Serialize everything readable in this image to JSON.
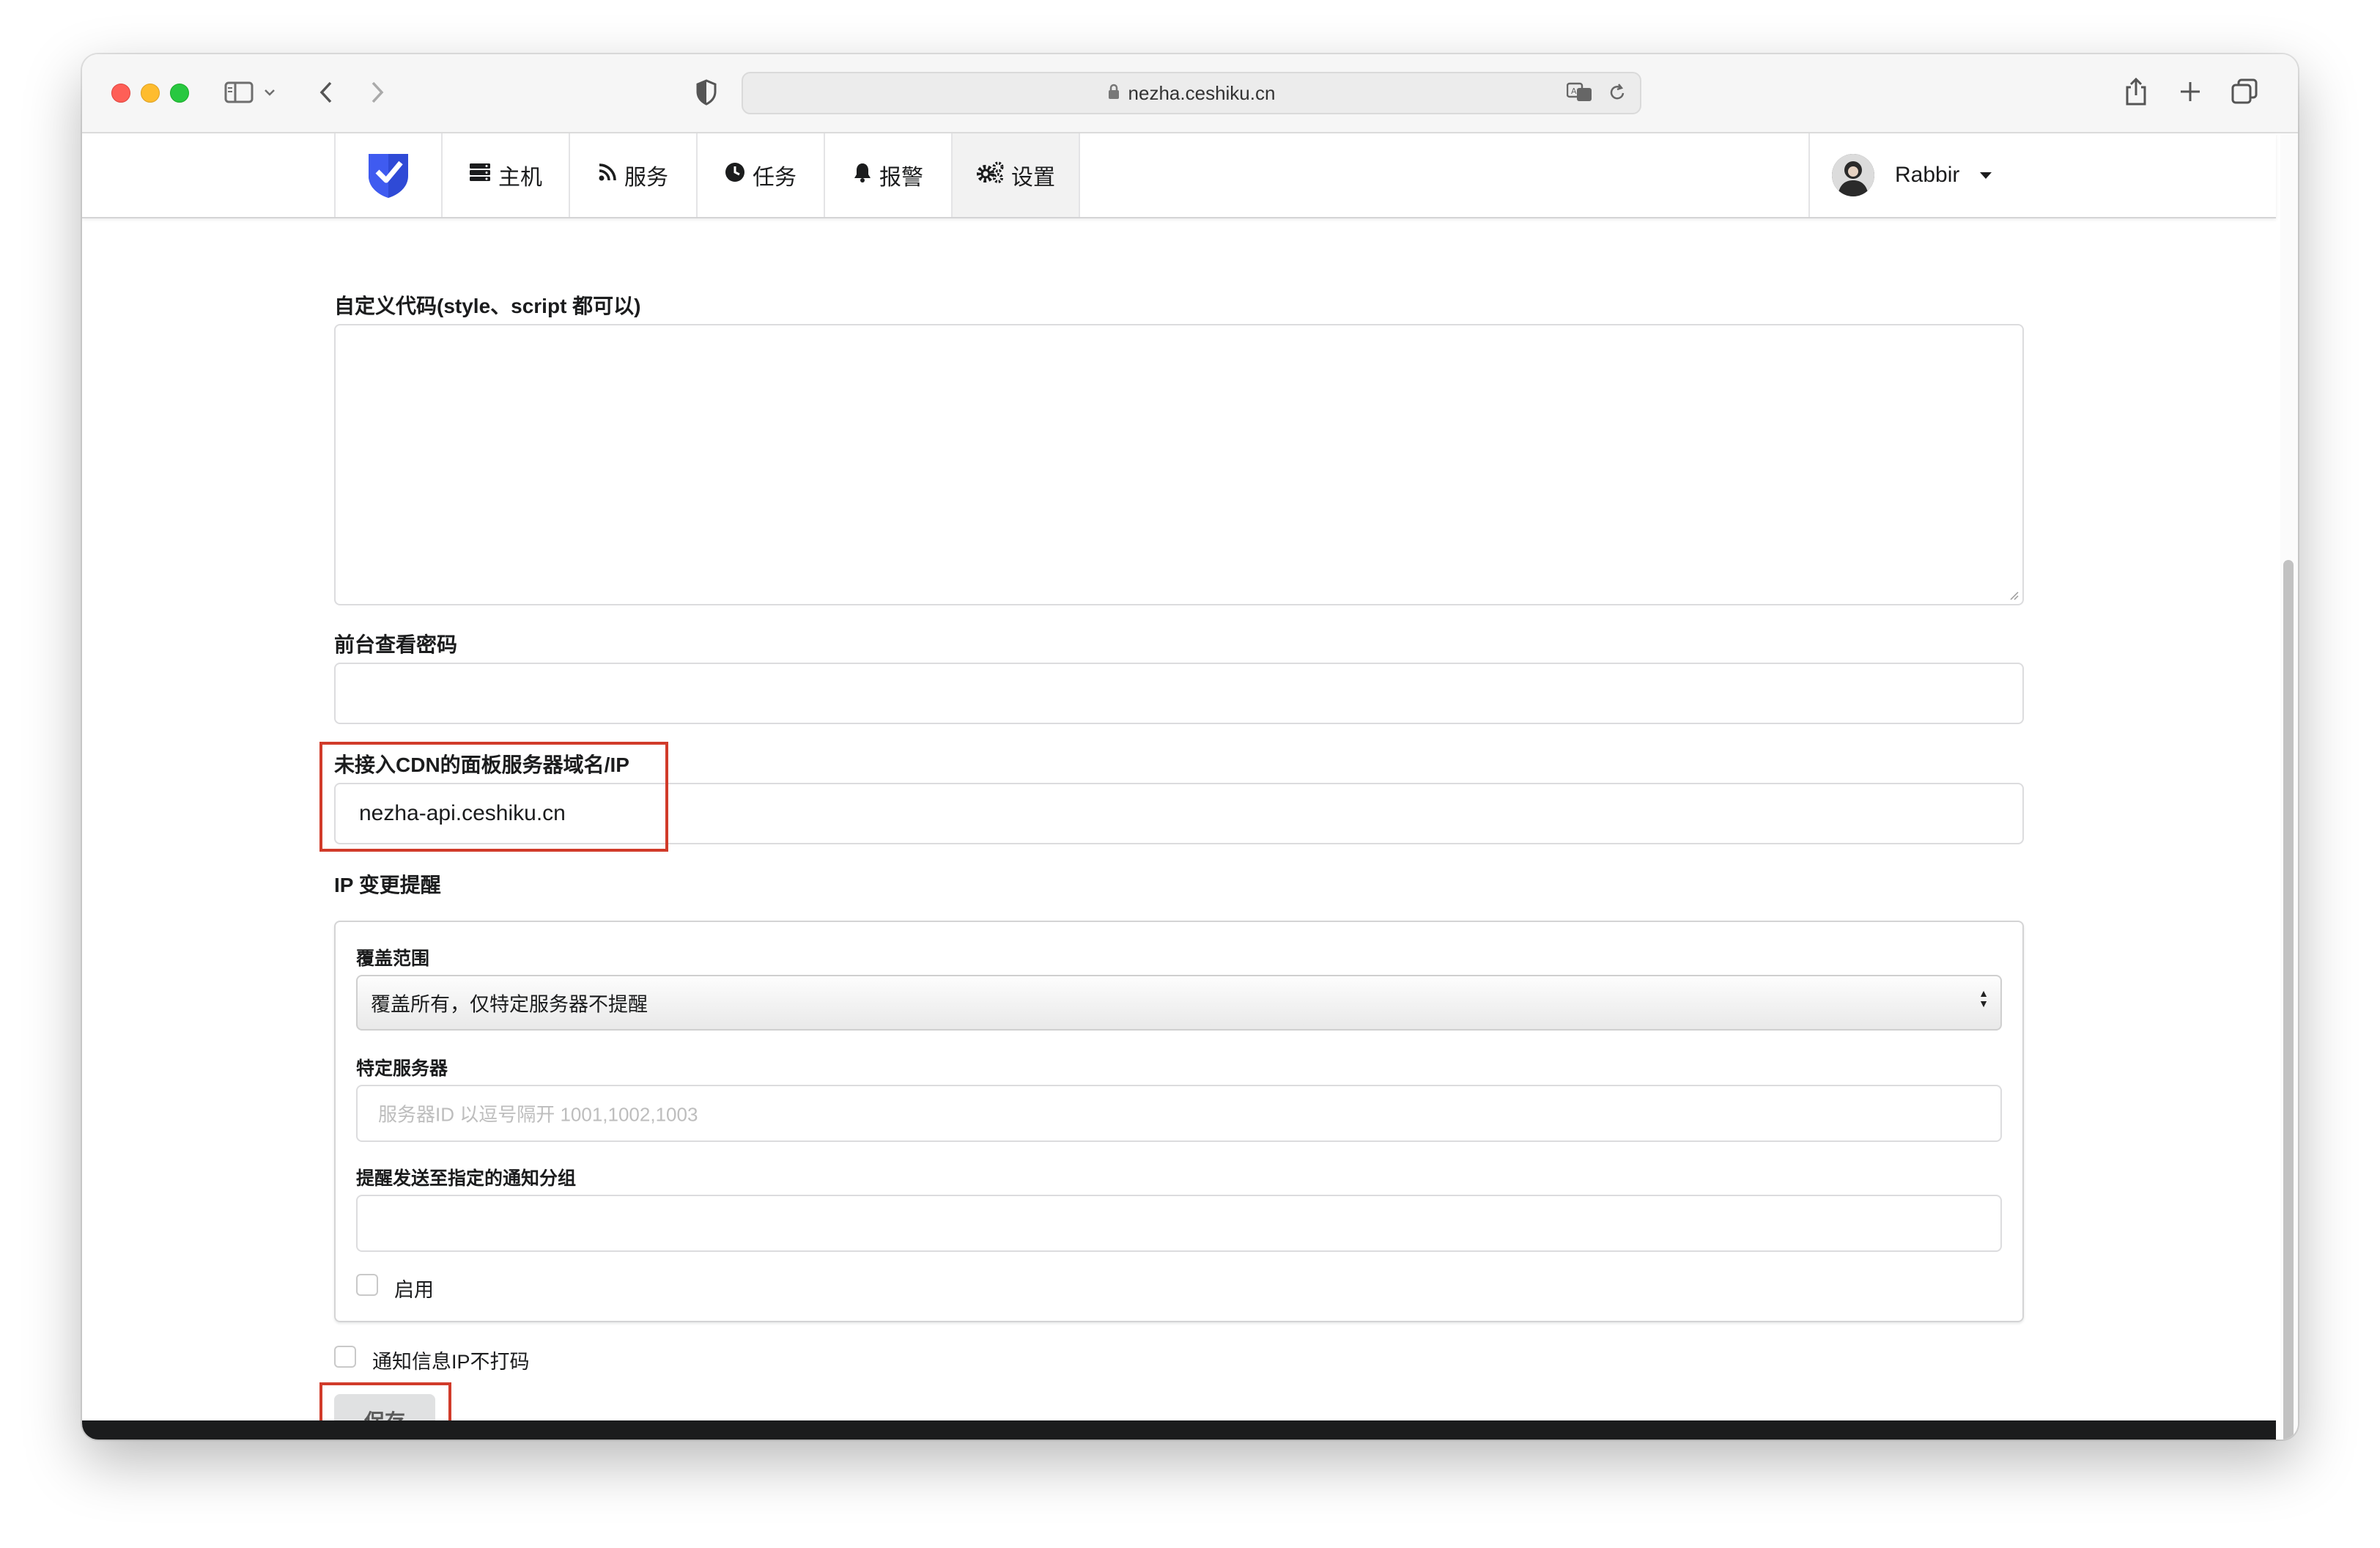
{
  "browser": {
    "url": "nezha.ceshiku.cn",
    "icons": [
      "sidebar-icon",
      "chevron-down-icon",
      "back-icon",
      "forward-icon",
      "shield-icon",
      "lock-icon",
      "translate-icon",
      "reload-icon",
      "share-icon",
      "new-tab-icon",
      "tabs-overview-icon"
    ]
  },
  "nav": {
    "items": [
      {
        "label": "主机",
        "icon": "server-icon"
      },
      {
        "label": "服务",
        "icon": "rss-icon"
      },
      {
        "label": "任务",
        "icon": "clock-icon"
      },
      {
        "label": "报警",
        "icon": "bell-icon"
      },
      {
        "label": "设置",
        "icon": "cogs-icon",
        "active": true
      }
    ],
    "user": {
      "name": "Rabbir"
    }
  },
  "form": {
    "custom_code": {
      "label": "自定义代码(style、script 都可以)",
      "value": ""
    },
    "view_password": {
      "label": "前台查看密码",
      "value": ""
    },
    "panel_domain": {
      "label": "未接入CDN的面板服务器域名/IP",
      "value": "nezha-api.ceshiku.cn"
    },
    "ip_change": {
      "label": "IP 变更提醒",
      "coverage": {
        "label": "覆盖范围",
        "selected": "覆盖所有，仅特定服务器不提醒"
      },
      "servers": {
        "label": "特定服务器",
        "placeholder": "服务器ID 以逗号隔开 1001,1002,1003"
      },
      "notify_group": {
        "label": "提醒发送至指定的通知分组",
        "value": ""
      },
      "enable": {
        "label": "启用",
        "checked": false
      }
    },
    "hide_ip": {
      "label": "通知信息IP不打码",
      "checked": false
    },
    "save_label": "保存"
  },
  "colors": {
    "highlight": "#d13b2a",
    "accent_logo": "#2f4ad6",
    "footer": "#1b1c1d"
  }
}
